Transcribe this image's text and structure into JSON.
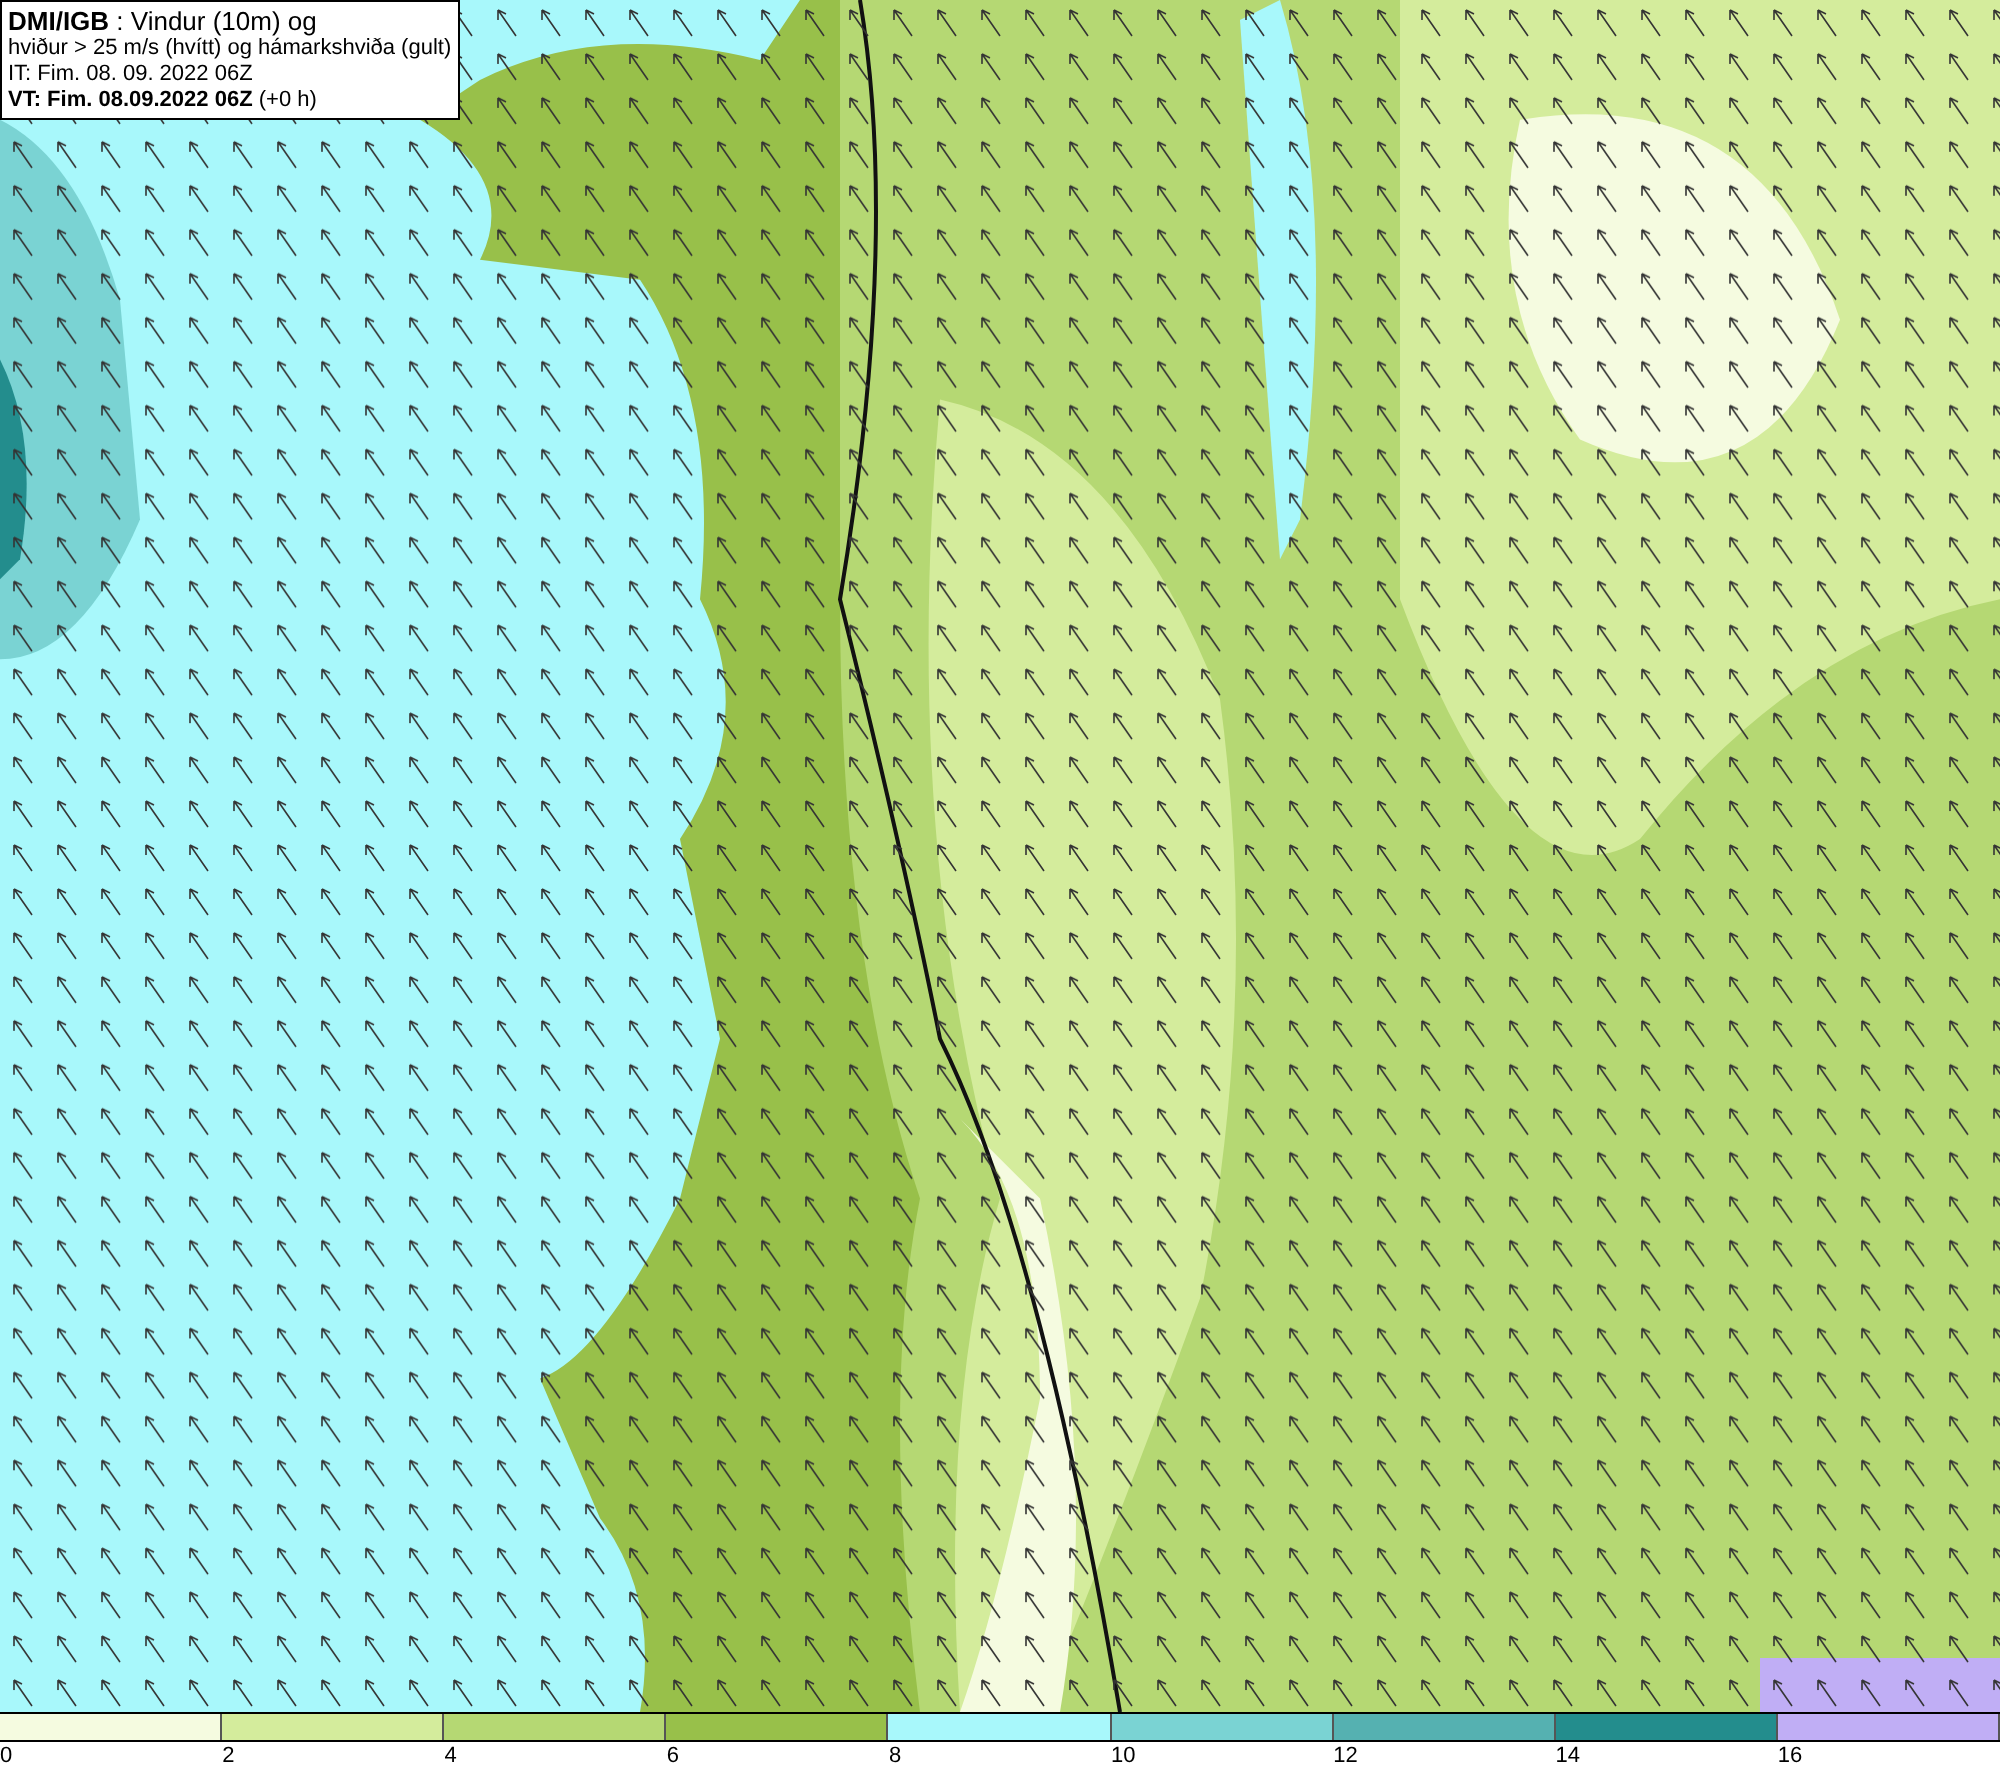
{
  "title_box": {
    "lines": [
      "**DMI/IGB** : Vindur (10m) og",
      "hviður > 25 m/s (hvítt) og hámarkshviða (gult)",
      "IT: Fim. 08. 09. 2022 06Z",
      "**VT: Fim. 08.09.2022 06Z** (+0 h)"
    ]
  },
  "legend": {
    "swatches": [
      {
        "color": "#f5fbe0"
      },
      {
        "color": "#d4ec9c"
      },
      {
        "color": "#b5d873"
      },
      {
        "color": "#98c04a"
      },
      {
        "color": "#a8f8fb"
      },
      {
        "color": "#7ad3d3"
      },
      {
        "color": "#55b1b1"
      },
      {
        "color": "#238d8d"
      },
      {
        "color": "#c0aef5"
      }
    ],
    "ticks": [
      "0",
      "2",
      "4",
      "6",
      "8",
      "10",
      "12",
      "14",
      "16"
    ]
  }
}
